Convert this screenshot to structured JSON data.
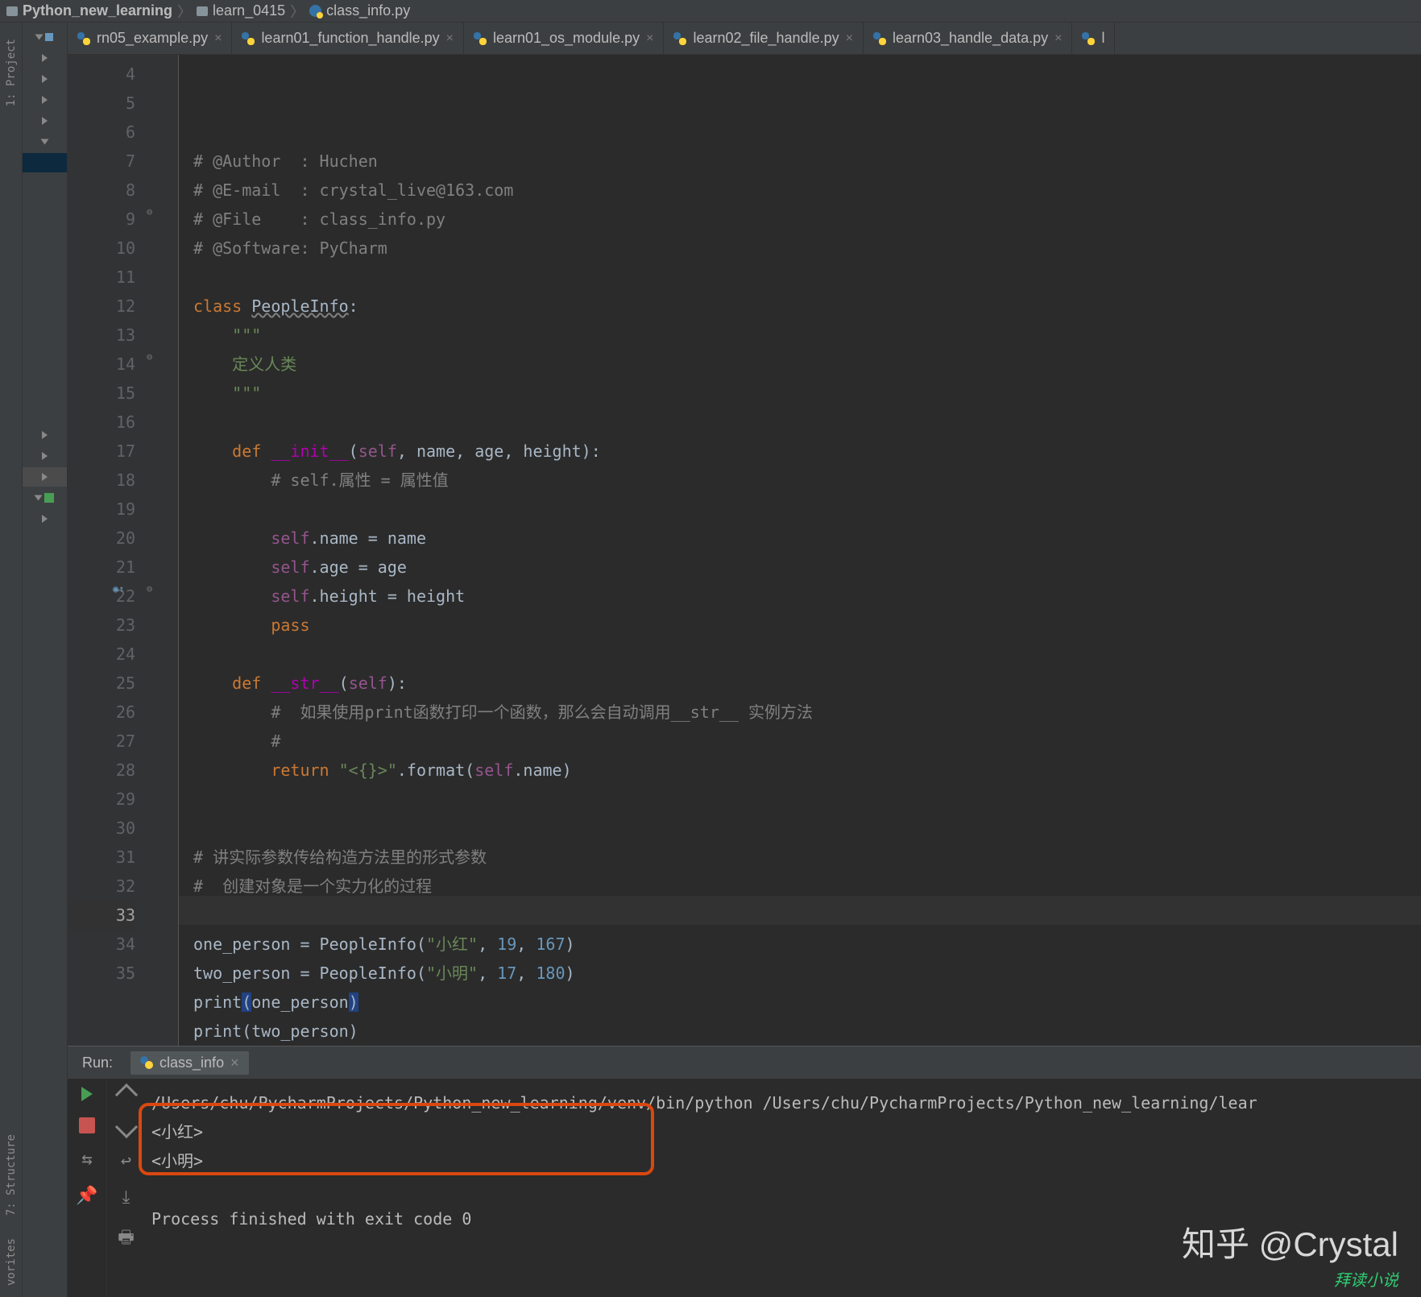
{
  "breadcrumbs": {
    "project": "Python_new_learning",
    "folder": "learn_0415",
    "file": "class_info.py"
  },
  "tabs": [
    {
      "label": "rn05_example.py"
    },
    {
      "label": "learn01_function_handle.py"
    },
    {
      "label": "learn01_os_module.py"
    },
    {
      "label": "learn02_file_handle.py"
    },
    {
      "label": "learn03_handle_data.py"
    },
    {
      "label": "l"
    }
  ],
  "gutter_start": 4,
  "gutter_end": 35,
  "current_line": 33,
  "code": {
    "l4": {
      "pre": "# @Author  : ",
      "txt": "Huchen"
    },
    "l5": {
      "pre": "# @E-mail  : ",
      "txt": "crystal_live@163.com"
    },
    "l6": {
      "pre": "# @File    : ",
      "txt": "class_info.py"
    },
    "l7": {
      "pre": "# @Software: ",
      "txt": "PyCharm"
    },
    "l9": {
      "kw": "class ",
      "cls": "PeopleInfo",
      "colon": ":"
    },
    "l10": "\"\"\"",
    "l11": "定义人类",
    "l12": "\"\"\"",
    "l14": {
      "kw": "def ",
      "fn": "__init__",
      "p": "(",
      "self": "self",
      "args": ", name, age, height):"
    },
    "l15": "# self.属性 = 属性值",
    "l17": {
      "self": "self",
      "rest": ".name = name"
    },
    "l18": {
      "self": "self",
      "rest": ".age = age"
    },
    "l19": {
      "self": "self",
      "rest": ".height = height"
    },
    "l20": {
      "kw": "pass"
    },
    "l22": {
      "kw": "def ",
      "fn": "__str__",
      "p": "(",
      "self": "self",
      "args": "):"
    },
    "l23": "#  如果使用print函数打印一个函数，那么会自动调用__str__ 实例方法",
    "l24": "#",
    "l25": {
      "kw": "return ",
      "str": "\"<{}>\"",
      "fmt": ".format(",
      "self": "self",
      "rest": ".name)"
    },
    "l28": "# 讲实际参数传给构造方法里的形式参数",
    "l29": "#  创建对象是一个实力化的过程",
    "l31": {
      "v": "one_person = PeopleInfo(",
      "s": "\"小红\"",
      "c1": ", ",
      "n1": "19",
      "c2": ", ",
      "n2": "167",
      "e": ")"
    },
    "l32": {
      "v": "two_person = PeopleInfo(",
      "s": "\"小明\"",
      "c1": ", ",
      "n1": "17",
      "c2": ", ",
      "n2": "180",
      "e": ")"
    },
    "l33": {
      "fn": "print",
      "p": "(one_person)"
    },
    "l34": {
      "fn": "print",
      "p": "(two_person)"
    }
  },
  "run": {
    "label": "Run:",
    "tab": "class_info",
    "cmd": "/Users/chu/PycharmProjects/Python_new_learning/venv/bin/python /Users/chu/PycharmProjects/Python_new_learning/lear",
    "out1": "<小红>",
    "out2": "<小明>",
    "exit": "Process finished with exit code 0"
  },
  "sidebar": {
    "project": "1: Project",
    "structure": "7: Structure",
    "favorites": "vorites"
  },
  "watermark": "知乎 @Crystal",
  "watermark2": "拜读小说"
}
